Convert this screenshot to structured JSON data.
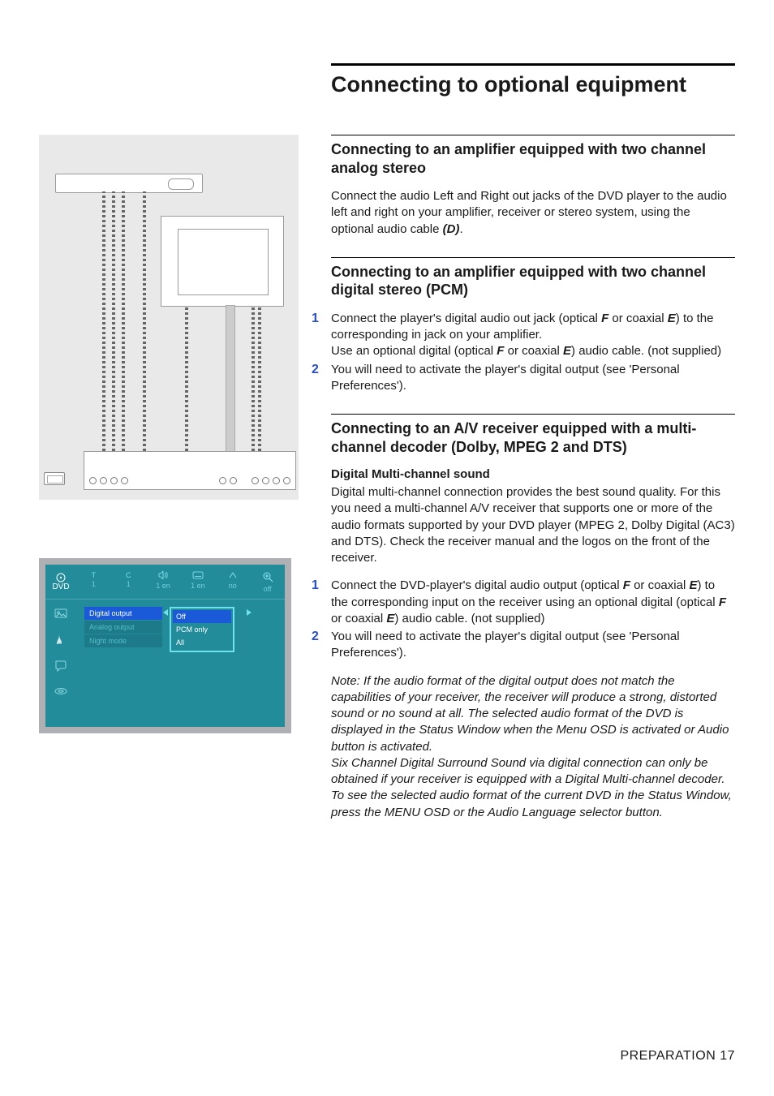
{
  "title": "Connecting to optional equipment",
  "sections": {
    "analog": {
      "heading": "Connecting to an amplifier equipped with two channel analog stereo",
      "para": "Connect the audio Left and Right out jacks of the DVD player to the audio left and right on your amplifier, receiver or stereo system, using the optional audio cable ",
      "cable": "(D)",
      "para_tail": "."
    },
    "pcm": {
      "heading": "Connecting to an amplifier equipped with two channel digital stereo (PCM)",
      "step1a": "Connect the player's digital audio out jack (optical ",
      "step1b": " or coaxial ",
      "step1c": ") to the corresponding in jack on your amplifier.",
      "step1d": "Use an optional digital (optical ",
      "step1e": " or coaxial ",
      "step1f": ") audio cable. (not supplied)",
      "label_f": "F",
      "label_e": "E",
      "step2": "You will need to activate the player's digital output (see 'Personal Preferences')."
    },
    "av": {
      "heading": "Connecting to an A/V receiver equipped with a multi-channel decoder (Dolby, MPEG 2 and DTS)",
      "subhead": "Digital Multi-channel sound",
      "para": "Digital multi-channel connection provides the best sound quality. For this you need a multi-channel A/V receiver that supports one or more of the audio formats supported by your DVD player (MPEG 2, Dolby Digital (AC3) and DTS). Check the receiver manual and the logos on the front of the receiver.",
      "step1a": "Connect the DVD-player's digital audio output (optical ",
      "step1b": " or coaxial ",
      "step1c": ") to the corresponding input on the receiver using an optional digital (optical ",
      "step1d": " or coaxial ",
      "step1e": ") audio cable. (not supplied)",
      "label_f": "F",
      "label_e": "E",
      "step2": "You will need to activate the player's digital output (see 'Personal Preferences').",
      "note_label": "Note:  ",
      "note1": "If the audio format of the digital output does not match the capabilities of your receiver, the receiver will produce a strong, distorted sound or no sound at all. The selected audio format of the DVD is displayed in the Status Window when the Menu OSD is activated or Audio button is activated.",
      "note2": "Six Channel Digital Surround Sound via digital connection can only be obtained if your receiver is equipped with a Digital Multi-channel decoder.",
      "note3": "To see the selected audio format of the current DVD in the Status Window, press the MENU OSD or the Audio Language selector button."
    }
  },
  "osd": {
    "topbar": [
      "T",
      "C",
      "",
      "",
      "",
      ""
    ],
    "topvals": [
      "1",
      "1",
      "1 en",
      "1 en",
      "no",
      "off"
    ],
    "side_label": "DVD",
    "menu": {
      "items": [
        "Digital output",
        "Analog output",
        "Night mode"
      ]
    },
    "submenu": {
      "items": [
        "Off",
        "PCM only",
        "All"
      ]
    }
  },
  "footer": {
    "section": "PREPARATION",
    "page": "17"
  }
}
